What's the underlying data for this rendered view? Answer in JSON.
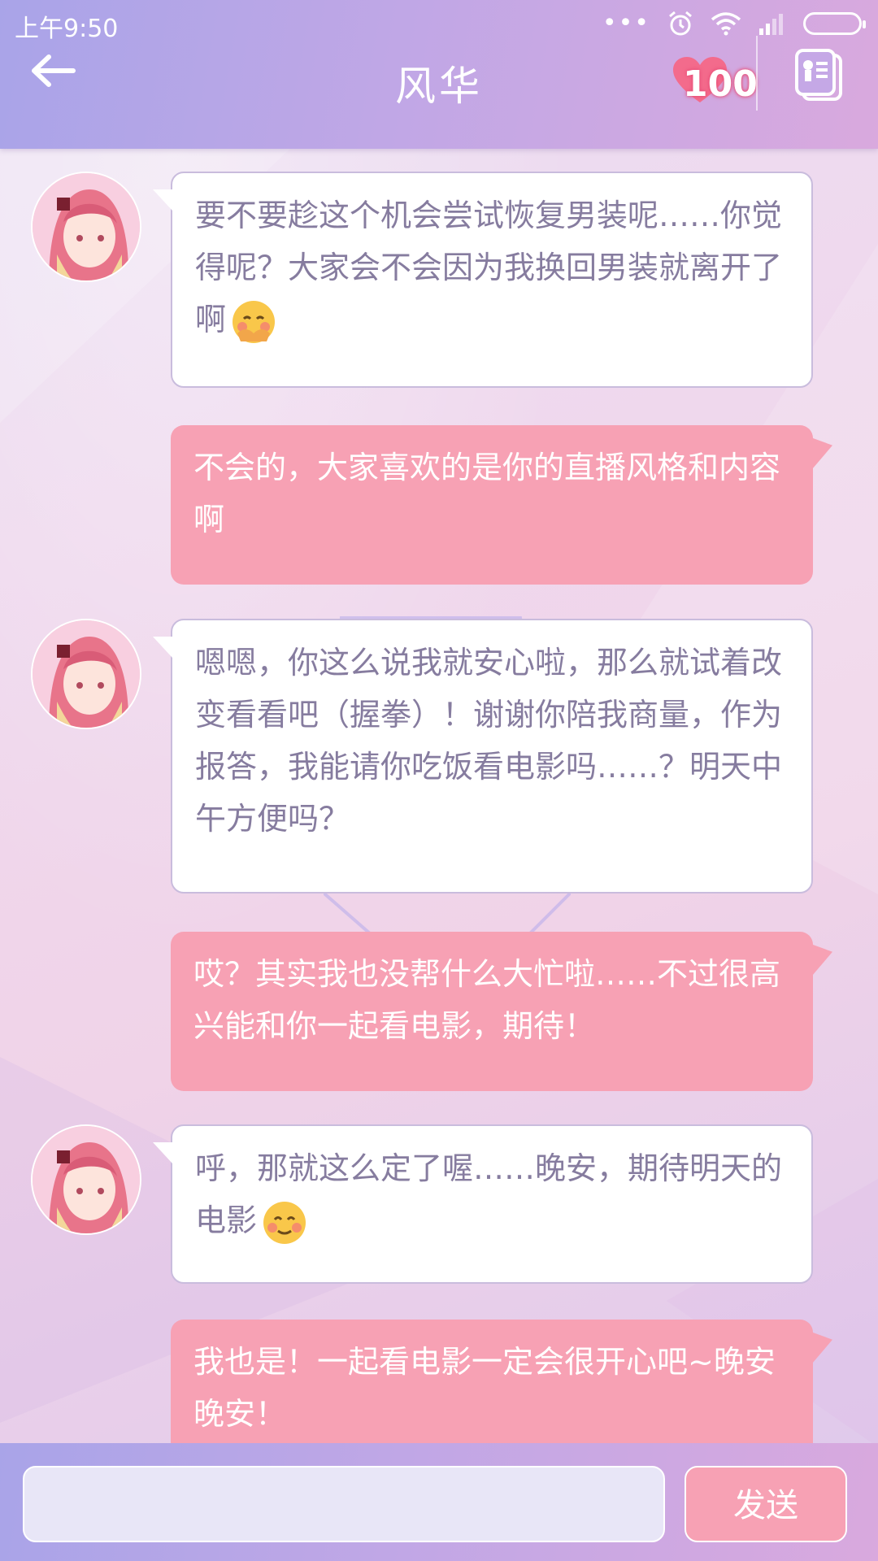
{
  "status": {
    "time": "上午9:50",
    "dots": "•••"
  },
  "header": {
    "title": "风华",
    "affinity": "100"
  },
  "messages": [
    {
      "from": "other",
      "text": "要不要趁这个机会尝试恢复男装呢……你觉得呢？大家会不会因为我换回男装就离开了啊",
      "emoji": "shy-face-icon"
    },
    {
      "from": "me",
      "text": "不会的，大家喜欢的是你的直播风格和内容啊"
    },
    {
      "from": "other",
      "text": "嗯嗯，你这么说我就安心啦，那么就试着改变看看吧（握拳）！谢谢你陪我商量，作为报答，我能请你吃饭看电影吗……？明天中午方便吗？"
    },
    {
      "from": "me",
      "text": "哎？其实我也没帮什么大忙啦……不过很高兴能和你一起看电影，期待！"
    },
    {
      "from": "other",
      "text": "呼，那就这么定了喔……晚安，期待明天的电影",
      "emoji": "smile-face-icon"
    },
    {
      "from": "me",
      "text": "我也是！一起看电影一定会很开心吧~晚安晚安！"
    }
  ],
  "composer": {
    "input_value": "",
    "send_label": "发送"
  },
  "colors": {
    "header": "#b7a6e7",
    "bubble_in": "#ffffff",
    "bubble_out": "#f7a1b4",
    "text_in": "#867c9f"
  }
}
